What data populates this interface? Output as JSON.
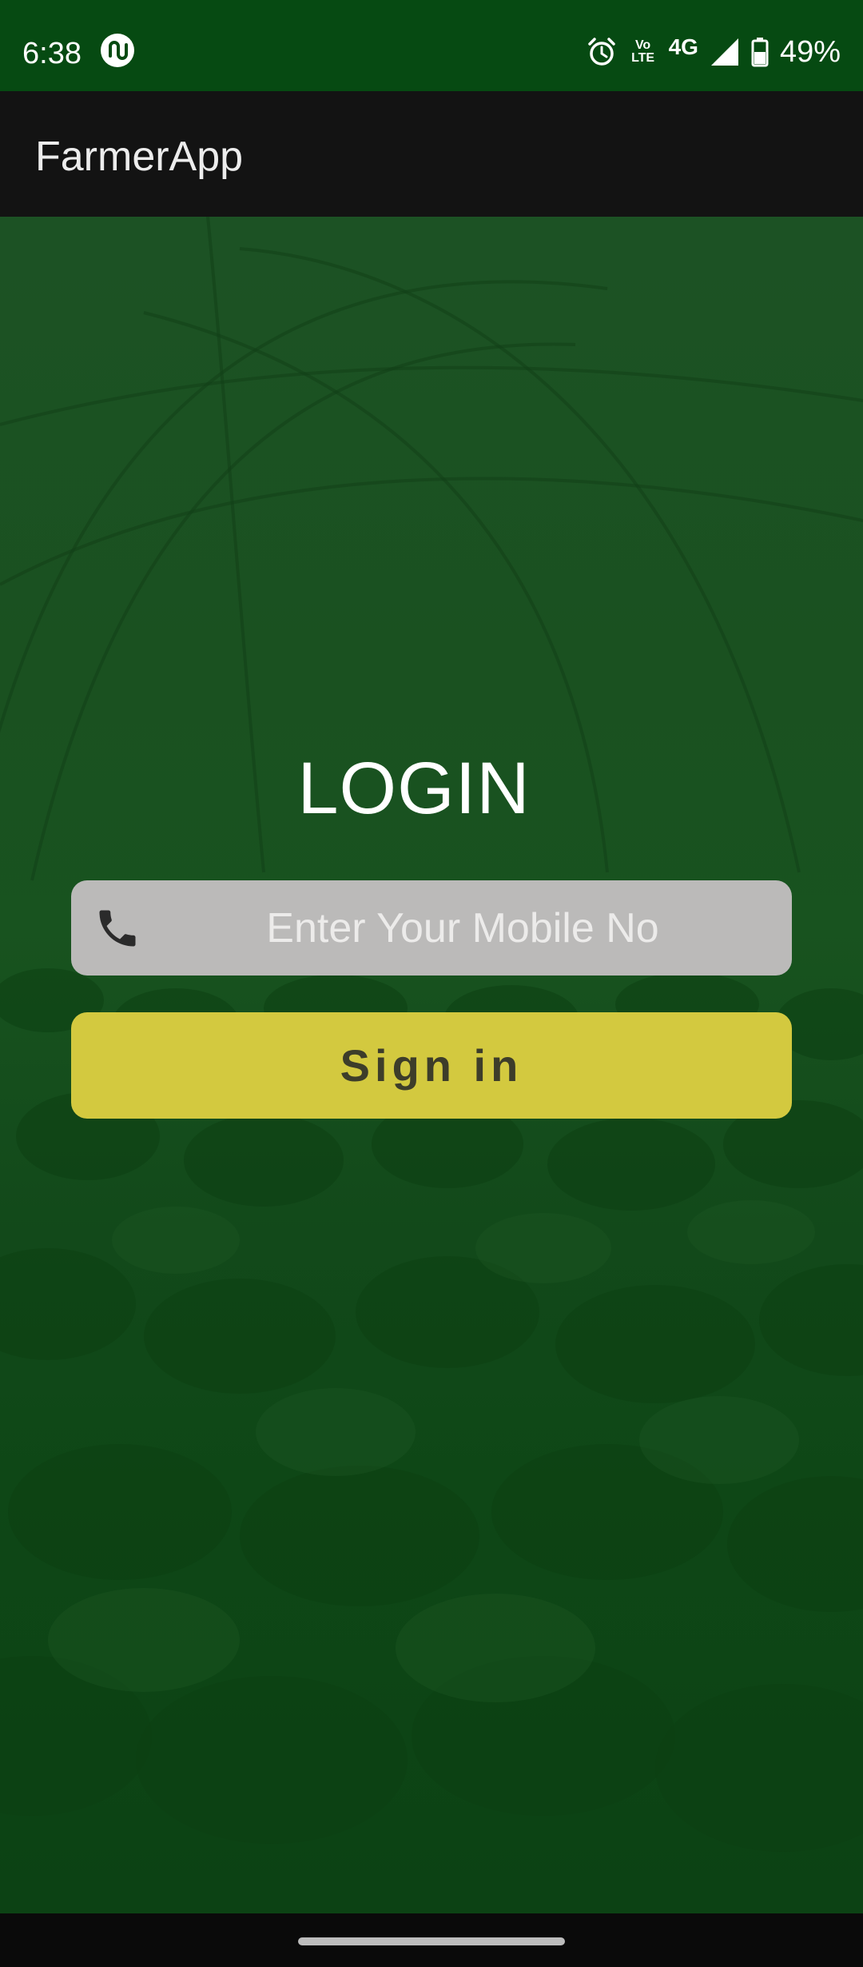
{
  "status_bar": {
    "time": "6:38",
    "app_icon": "sync-app-icon",
    "alarm_icon": "alarm-icon",
    "volte_label": "Vo\nLTE",
    "network_label": "4G",
    "signal_icon": "signal-icon",
    "battery_icon": "battery-icon",
    "battery_text": "49%"
  },
  "app_bar": {
    "title": "FarmerApp"
  },
  "login": {
    "title": "LOGIN",
    "phone_icon": "phone-icon",
    "mobile_placeholder": "Enter Your Mobile No",
    "mobile_value": "",
    "signin_label": "Sign in"
  },
  "colors": {
    "status_bar_bg": "#064a12",
    "app_bar_bg": "#131313",
    "background_green": "#1a5120",
    "input_bg": "#bbbab9",
    "button_bg": "#d3c93f",
    "button_text": "#3d3d2a"
  }
}
